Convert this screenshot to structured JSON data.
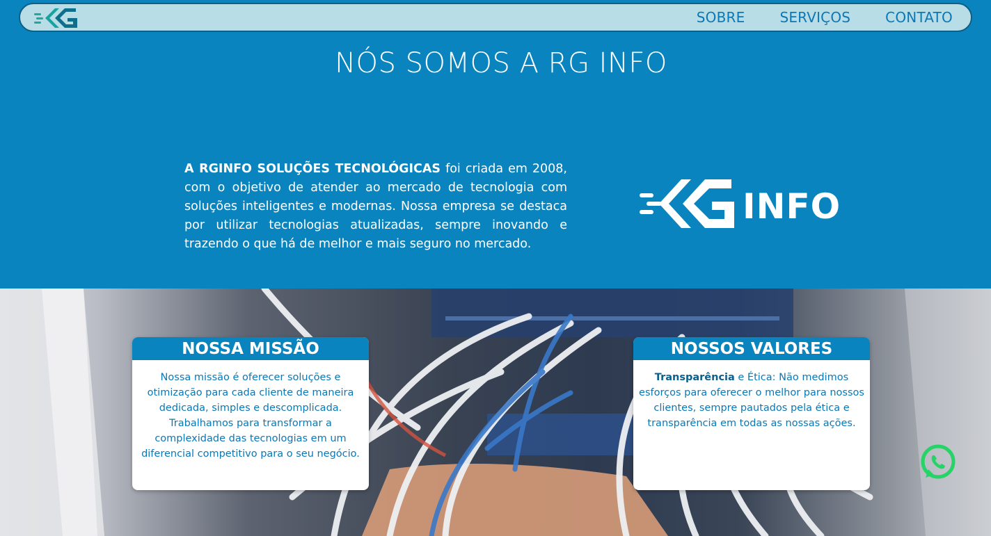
{
  "nav": {
    "logo_icon": "rg-logo-icon",
    "links": [
      "SOBRE",
      "SERVIÇOS",
      "CONTATO"
    ]
  },
  "hero": {
    "title": "NÓS SOMOS A RG INFO",
    "about_bold": "A RGINFO SOLUÇÕES TECNOLÓGICAS",
    "about_rest": " foi criada em 2008, com o objetivo de atender ao mercado de tecnologia com soluções inteligentes e modernas. Nossa empresa se destaca por utilizar tecnologias atualizadas, sempre inovando e trazendo o que há de melhor e mais seguro no mercado.",
    "logo_text": "INFO"
  },
  "cards": {
    "mission": {
      "title": "NOSSA MISSÃO",
      "text": "Nossa missão é oferecer soluções e otimização para cada cliente de maneira dedicada, simples e descomplicada. Trabalhamos para transformar a complexidade das tecnologias em um diferencial competitivo para o seu negócio."
    },
    "values": {
      "title": "NOSSOS VALORES",
      "text_bold": "Transparência",
      "text_rest": " e Ética: Não medimos esforços para oferecer o melhor para nossos clientes, sempre pautados pela ética e transparência em todas as nossas ações."
    }
  },
  "colors": {
    "primary": "#0a84be",
    "nav_bg": "#b9dde6",
    "whatsapp": "#25d366"
  },
  "floating": {
    "icon": "whatsapp-icon"
  }
}
